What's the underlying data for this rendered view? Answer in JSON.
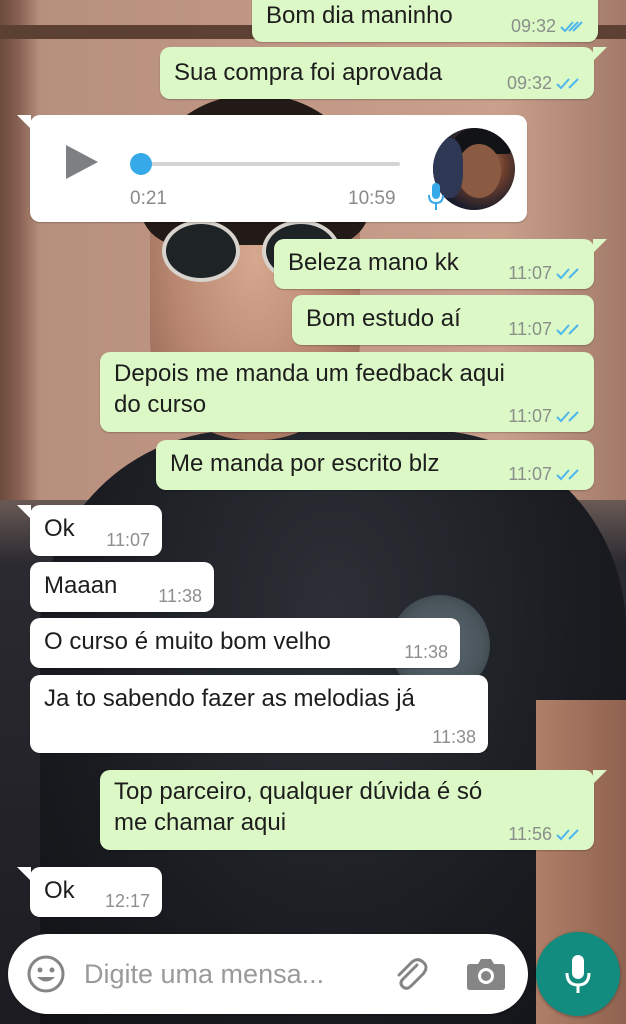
{
  "colors": {
    "outgoing_bubble": "#dcf8c6",
    "incoming_bubble": "#ffffff",
    "read_ticks": "#4fb6ec",
    "accent": "#128c7e",
    "seek_knob": "#36a9e8"
  },
  "messages": [
    {
      "direction": "out",
      "text": "Bom dia maninho",
      "time": "09:32",
      "status": "read"
    },
    {
      "direction": "out",
      "text": "Sua compra foi aprovada",
      "time": "09:32",
      "status": "read"
    },
    {
      "direction": "in",
      "type": "voice",
      "duration": "0:21",
      "time": "10:59",
      "progress": 0.0
    },
    {
      "direction": "out",
      "text": "Beleza mano kk",
      "time": "11:07",
      "status": "read"
    },
    {
      "direction": "out",
      "text": "Bom estudo aí",
      "time": "11:07",
      "status": "read"
    },
    {
      "direction": "out",
      "text_line1": "Depois me manda um feedback aqui",
      "text_line2": "do curso",
      "time": "11:07",
      "status": "read"
    },
    {
      "direction": "out",
      "text": "Me manda por escrito blz",
      "time": "11:07",
      "status": "read"
    },
    {
      "direction": "in",
      "text": "Ok",
      "time": "11:07"
    },
    {
      "direction": "in",
      "text": "Maaan",
      "time": "11:38"
    },
    {
      "direction": "in",
      "text": "O curso é muito bom velho",
      "time": "11:38"
    },
    {
      "direction": "in",
      "text": "Ja to sabendo fazer as melodias já",
      "time": "11:38"
    },
    {
      "direction": "out",
      "text_line1": "Top parceiro, qualquer dúvida é só",
      "text_line2": "me chamar aqui",
      "time": "11:56",
      "status": "read"
    },
    {
      "direction": "in",
      "text": "Ok",
      "time": "12:17"
    }
  ],
  "composer": {
    "placeholder": "Digite uma mensa...",
    "emoji_icon": "emoji-icon",
    "attach_icon": "paperclip-icon",
    "camera_icon": "camera-icon",
    "send_icon": "microphone-icon"
  }
}
